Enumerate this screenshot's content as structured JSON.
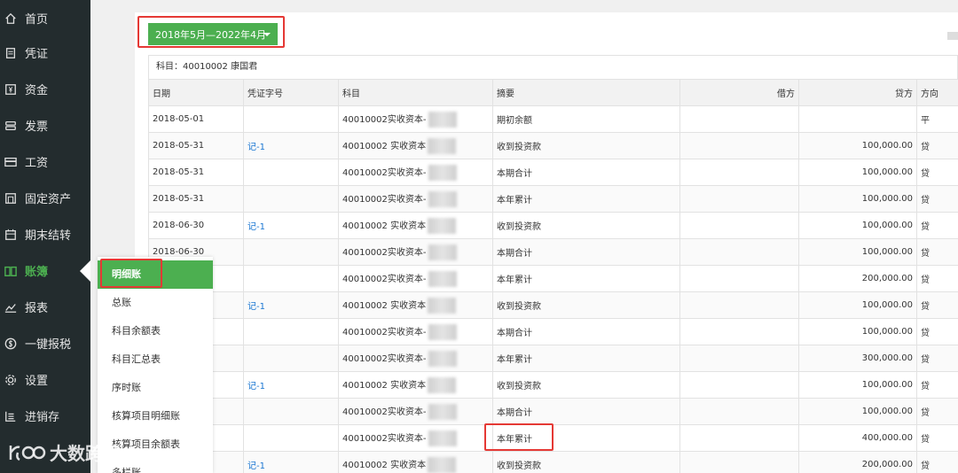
{
  "sidebar": {
    "items": [
      {
        "label": "首页",
        "icon": "home-icon"
      },
      {
        "label": "凭证",
        "icon": "voucher-icon"
      },
      {
        "label": "资金",
        "icon": "money-icon"
      },
      {
        "label": "发票",
        "icon": "invoice-icon"
      },
      {
        "label": "工资",
        "icon": "salary-icon"
      },
      {
        "label": "固定资产",
        "icon": "fixed-asset-icon"
      },
      {
        "label": "期末结转",
        "icon": "calendar-icon"
      },
      {
        "label": "账簿",
        "icon": "book-icon",
        "active": true
      },
      {
        "label": "报表",
        "icon": "chart-icon"
      },
      {
        "label": "一键报税",
        "icon": "tax-icon"
      },
      {
        "label": "设置",
        "icon": "gear-icon"
      },
      {
        "label": "进销存",
        "icon": "inventory-icon"
      }
    ]
  },
  "submenu": {
    "items": [
      "明细账",
      "总账",
      "科目余额表",
      "科目汇总表",
      "序时账",
      "核算项目明细账",
      "核算项目余额表",
      "多栏账"
    ]
  },
  "period_button": {
    "label": "2018年5月—2022年4月"
  },
  "subject_line": "科目：40010002 康国君",
  "table": {
    "headers": [
      "日期",
      "凭证字号",
      "科目",
      "摘要",
      "借方",
      "贷方",
      "方向"
    ],
    "rows": [
      {
        "date": "2018-05-01",
        "voucher": "",
        "subject": "40010002实收资本-",
        "summary": "期初余额",
        "debit": "",
        "credit": "",
        "dir": "平"
      },
      {
        "date": "2018-05-31",
        "voucher": "记-1",
        "subject": "40010002 实收资本",
        "summary": "收到投资款",
        "debit": "",
        "credit": "100,000.00",
        "dir": "贷"
      },
      {
        "date": "2018-05-31",
        "voucher": "",
        "subject": "40010002实收资本-",
        "summary": "本期合计",
        "debit": "",
        "credit": "100,000.00",
        "dir": "贷"
      },
      {
        "date": "2018-05-31",
        "voucher": "",
        "subject": "40010002实收资本-",
        "summary": "本年累计",
        "debit": "",
        "credit": "100,000.00",
        "dir": "贷"
      },
      {
        "date": "2018-06-30",
        "voucher": "记-1",
        "subject": "40010002 实收资本",
        "summary": "收到投资款",
        "debit": "",
        "credit": "100,000.00",
        "dir": "贷"
      },
      {
        "date": "2018-06-30",
        "voucher": "",
        "subject": "40010002实收资本-",
        "summary": "本期合计",
        "debit": "",
        "credit": "100,000.00",
        "dir": "贷"
      },
      {
        "date": "",
        "voucher": "",
        "subject": "40010002实收资本-",
        "summary": "本年累计",
        "debit": "",
        "credit": "200,000.00",
        "dir": "贷"
      },
      {
        "date": "",
        "voucher": "记-1",
        "subject": "40010002 实收资本",
        "summary": "收到投资款",
        "debit": "",
        "credit": "100,000.00",
        "dir": "贷"
      },
      {
        "date": "",
        "voucher": "",
        "subject": "40010002实收资本-",
        "summary": "本期合计",
        "debit": "",
        "credit": "100,000.00",
        "dir": "贷"
      },
      {
        "date": "",
        "voucher": "",
        "subject": "40010002实收资本-",
        "summary": "本年累计",
        "debit": "",
        "credit": "300,000.00",
        "dir": "贷"
      },
      {
        "date": "",
        "voucher": "记-1",
        "subject": "40010002 实收资本",
        "summary": "收到投资款",
        "debit": "",
        "credit": "100,000.00",
        "dir": "贷"
      },
      {
        "date": "",
        "voucher": "",
        "subject": "40010002实收资本-",
        "summary": "本期合计",
        "debit": "",
        "credit": "100,000.00",
        "dir": "贷"
      },
      {
        "date": "",
        "voucher": "",
        "subject": "40010002实收资本-",
        "summary": "本年累计",
        "debit": "",
        "credit": "400,000.00",
        "dir": "贷"
      },
      {
        "date": "",
        "voucher": "记-1",
        "subject": "40010002 实收资本",
        "summary": "收到投资款",
        "debit": "",
        "credit": "200,000.00",
        "dir": "贷"
      }
    ]
  },
  "watermark": {
    "text": "大数跨境"
  },
  "colors": {
    "sidebar_bg": "#232c2e",
    "accent": "#4caf50",
    "highlight": "#e53935",
    "link": "#1976d2"
  }
}
